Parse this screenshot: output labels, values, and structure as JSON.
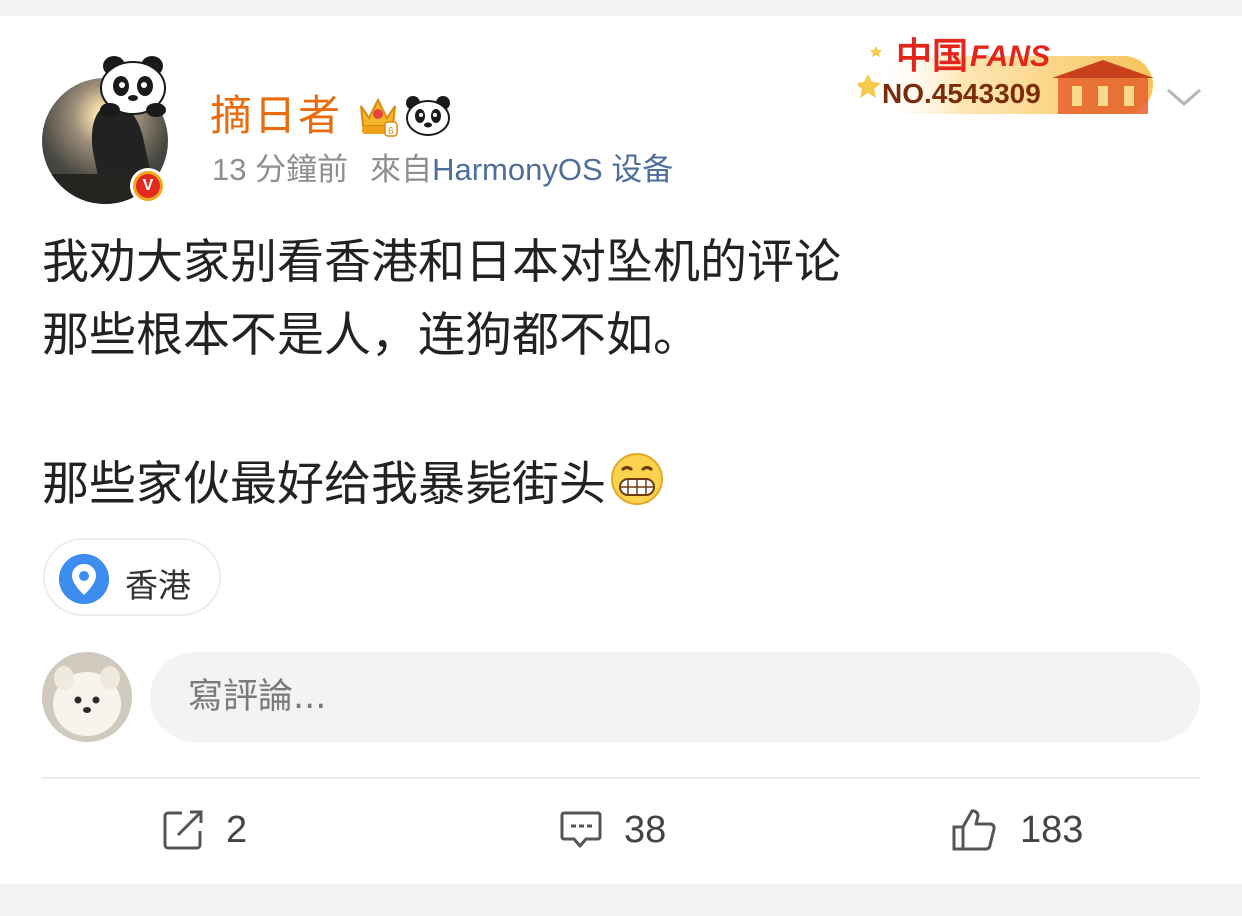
{
  "post": {
    "author": {
      "name": "摘日者"
    },
    "meta": {
      "time": "13 分鐘前",
      "source_prefix": "來自",
      "source_device": "HarmonyOS 设备"
    },
    "fans_badge": {
      "number": "NO.4543309"
    },
    "text_lines": [
      "我劝大家别看香港和日本对坠机的评论",
      "那些根本不是人，连狗都不如。",
      "",
      "那些家伙最好给我暴毙街头"
    ],
    "location": {
      "label": "香港"
    }
  },
  "comment_box": {
    "placeholder": "寫評論..."
  },
  "actions": {
    "repost": {
      "count": "2",
      "icon": "share-edit-icon"
    },
    "comment": {
      "count": "38",
      "icon": "comment-icon"
    },
    "like": {
      "count": "183",
      "icon": "thumbs-up-icon"
    }
  },
  "colors": {
    "username": "#e86b0c",
    "source_link": "#4e6e9c",
    "meta_gray": "#8e8e8e",
    "location_pin": "#3d8df0"
  }
}
